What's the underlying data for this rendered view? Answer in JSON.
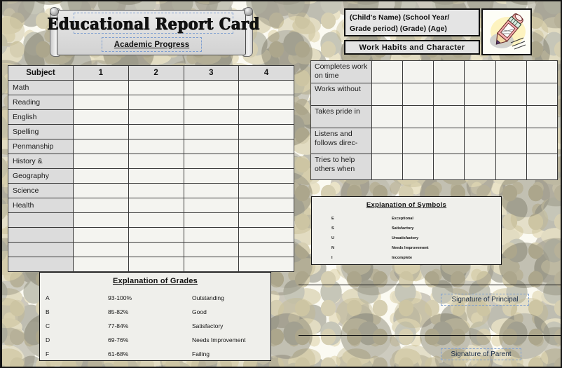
{
  "document": {
    "title": "Educational Report Card",
    "subtitle": "Academic Progress"
  },
  "header": {
    "info_line_1": "(Child's Name)    (School Year/",
    "info_line_2": "Grade period)  (Grade)  (Age)",
    "work_habits_title": "Work Habits and Character",
    "clipart": "pencil-icon"
  },
  "subject_table": {
    "columns": [
      "Subject",
      "1",
      "2",
      "3",
      "4"
    ],
    "rows": [
      "Math",
      "Reading",
      "English",
      "Spelling",
      "Penmanship",
      "History &",
      "Geography",
      "Science",
      "Health",
      "",
      "",
      "",
      ""
    ]
  },
  "work_habits_table": {
    "column_count": 6,
    "rows": [
      "Completes work on time",
      "Works without",
      "Takes pride in",
      "Listens and follows direc-",
      "Tries to help others when"
    ]
  },
  "symbols_legend": {
    "title": "Explanation of Symbols",
    "entries": [
      {
        "key": "E",
        "desc": "Exceptional"
      },
      {
        "key": "S",
        "desc": "Satisfactory"
      },
      {
        "key": "U",
        "desc": "Unsatisfactory"
      },
      {
        "key": "N",
        "desc": "Needs Improvement"
      },
      {
        "key": "I",
        "desc": "Incomplete"
      }
    ]
  },
  "grades_legend": {
    "title": "Explanation of Grades",
    "entries": [
      {
        "letter": "A",
        "range": "93-100%",
        "desc": "Outstanding"
      },
      {
        "letter": "B",
        "range": "85-82%",
        "desc": "Good"
      },
      {
        "letter": "C",
        "range": "77-84%",
        "desc": "Satisfactory"
      },
      {
        "letter": "D",
        "range": "69-76%",
        "desc": "Needs Improvement"
      },
      {
        "letter": "F",
        "range": "61-68%",
        "desc": "Failing"
      }
    ]
  },
  "signatures": {
    "principal_label": "Signature of Principal",
    "parent_label": "Signature of Parent"
  },
  "colors": {
    "paper": "#fbfaf2",
    "header_fill": "#e4e4e4",
    "table_header_fill": "#dcdcdc",
    "cell_fill": "#f4f4f0",
    "legend_fill": "#efefeb",
    "ink": "#111111",
    "placeholder_border": "#7f9fd0"
  }
}
